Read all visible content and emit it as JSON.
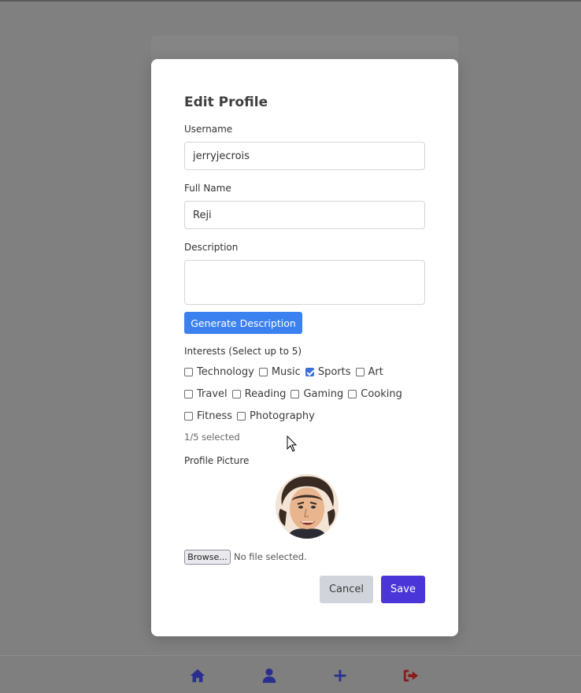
{
  "modal": {
    "title": "Edit Profile",
    "username": {
      "label": "Username",
      "value": "jerryjecrois"
    },
    "full_name": {
      "label": "Full Name",
      "value": "Reji"
    },
    "description": {
      "label": "Description",
      "value": ""
    },
    "generate_button": "Generate Description",
    "interests": {
      "label": "Interests (Select up to 5)",
      "options": [
        {
          "label": "Technology",
          "checked": false
        },
        {
          "label": "Music",
          "checked": false
        },
        {
          "label": "Sports",
          "checked": true
        },
        {
          "label": "Art",
          "checked": false
        },
        {
          "label": "Travel",
          "checked": false
        },
        {
          "label": "Reading",
          "checked": false
        },
        {
          "label": "Gaming",
          "checked": false
        },
        {
          "label": "Cooking",
          "checked": false
        },
        {
          "label": "Fitness",
          "checked": false
        },
        {
          "label": "Photography",
          "checked": false
        }
      ],
      "selected_count": "1/5 selected"
    },
    "profile_picture": {
      "label": "Profile Picture",
      "browse_button": "Browse...",
      "file_status": "No file selected."
    },
    "cancel_button": "Cancel",
    "save_button": "Save"
  },
  "bottom_nav": {
    "items": [
      {
        "icon": "home-icon",
        "color": "#2a2f8f"
      },
      {
        "icon": "user-icon",
        "color": "#2a2f8f"
      },
      {
        "icon": "plus-icon",
        "color": "#2a2f8f"
      },
      {
        "icon": "logout-icon",
        "color": "#8b1a1a"
      }
    ]
  },
  "colors": {
    "overlay": "#808080",
    "primary": "#3b82f0",
    "save": "#4a35d9",
    "cancel": "#d1d5db"
  }
}
